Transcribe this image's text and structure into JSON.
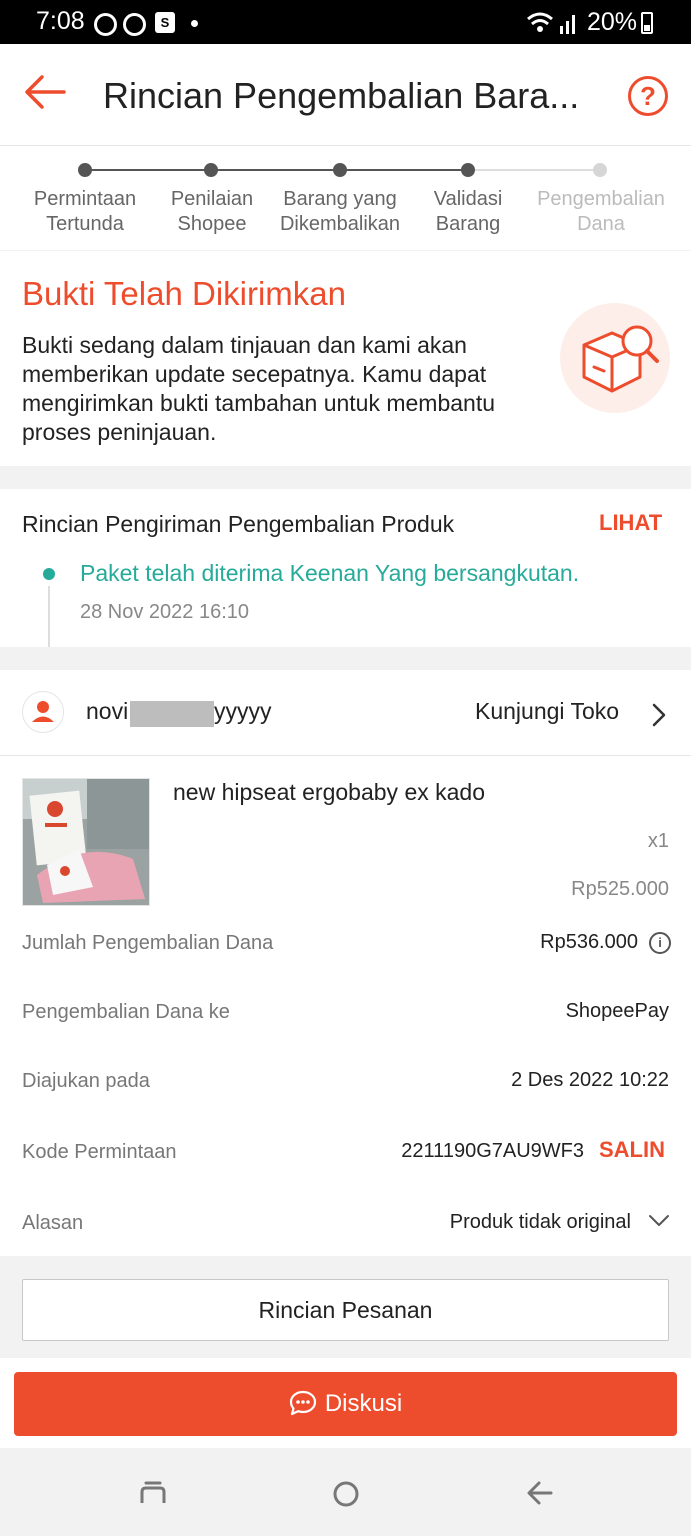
{
  "status_bar": {
    "time": "7:08",
    "notification_icon": "shopping-bag-icon",
    "battery": "20%"
  },
  "header": {
    "title": "Rincian Pengembalian Bara...",
    "back_icon": "arrow-left-icon",
    "help_label": "?"
  },
  "progress": {
    "steps": [
      {
        "label": "Permintaan\nTertunda",
        "active": true
      },
      {
        "label": "Penilaian\nShopee",
        "active": true
      },
      {
        "label": "Barang yang\nDikembalikan",
        "active": true
      },
      {
        "label": "Validasi\nBarang",
        "active": true
      },
      {
        "label": "Pengembalian\nDana",
        "active": false
      }
    ]
  },
  "status_card": {
    "title": "Bukti Telah Dikirimkan",
    "description": "Bukti sedang dalam tinjauan dan kami akan memberikan update secepatnya. Kamu dapat mengirimkan bukti tambahan untuk membantu proses peninjauan."
  },
  "shipping": {
    "title": "Rincian Pengiriman Pengembalian Produk",
    "action_label": "LIHAT",
    "event": "Paket telah diterima Keenan Yang bersangkutan.",
    "event_time": "28 Nov 2022 16:10"
  },
  "shop": {
    "name_prefix": "novi",
    "name_suffix": "yyyyy",
    "visit_label": "Kunjungi Toko"
  },
  "product": {
    "name": "new hipseat ergobaby ex kado",
    "quantity": "x1",
    "price": "Rp525.000"
  },
  "refund_info": {
    "amount_label": "Jumlah Pengembalian Dana",
    "amount_value": "Rp536.000",
    "destination_label": "Pengembalian Dana ke",
    "destination_value": "ShopeePay",
    "submitted_label": "Diajukan pada",
    "submitted_value": "2 Des 2022 10:22",
    "code_label": "Kode Permintaan",
    "code_value": "2211190G7AU9WF3",
    "copy_label": "SALIN",
    "reason_label": "Alasan",
    "reason_value": "Produk tidak original"
  },
  "buttons": {
    "order_detail": "Rincian Pesanan",
    "discuss": "Diskusi"
  },
  "colors": {
    "brand": "#ee4d2d",
    "teal": "#26aa99"
  }
}
